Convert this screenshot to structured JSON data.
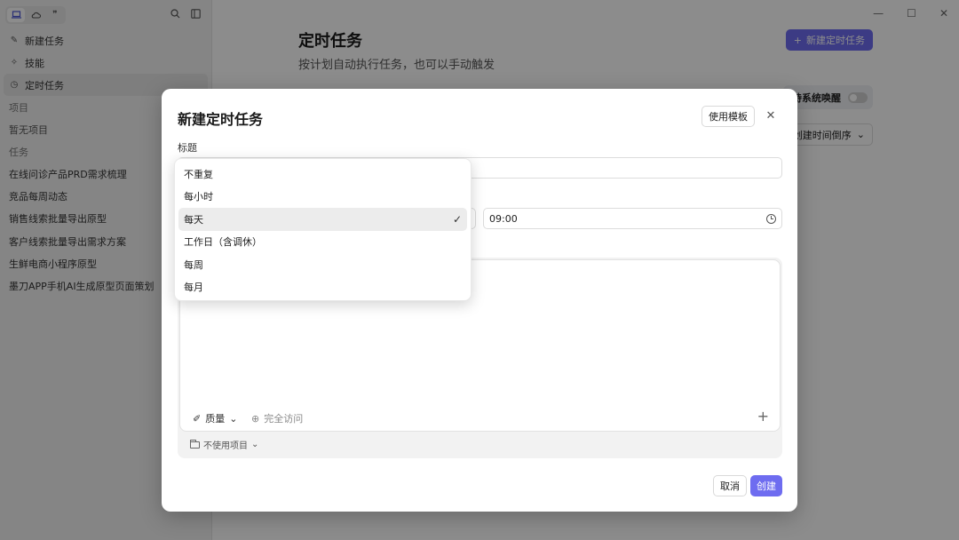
{
  "sidebar": {
    "nav": [
      {
        "label": "新建任务",
        "icon": "edit-icon"
      },
      {
        "label": "技能",
        "icon": "skills-icon"
      },
      {
        "label": "定时任务",
        "icon": "clock-icon"
      }
    ],
    "projects_title": "项目",
    "projects_empty": "暂无项目",
    "tasks_title": "任务",
    "tasks": [
      "在线问诊产品PRD需求梳理",
      "竞品每周动态",
      "销售线索批量导出原型",
      "客户线索批量导出需求方案",
      "生鲜电商小程序原型",
      "墨刀APP手机AI生成原型页面策划"
    ]
  },
  "main": {
    "title": "定时任务",
    "subtitle": "按计划自动执行任务，也可以手动触发",
    "new_button": "新建定时任务",
    "wake_label": "持系统唤醒",
    "sort_label": "创建时间倒序"
  },
  "modal": {
    "title": "新建定时任务",
    "template_button": "使用模板",
    "title_label": "标题",
    "time_value": "09:00",
    "quality_label": "质量",
    "access_label": "完全访问",
    "project_label": "不使用项目",
    "cancel_label": "取消",
    "create_label": "创建"
  },
  "dropdown": {
    "options": [
      "不重复",
      "每小时",
      "每天",
      "工作日（含调休）",
      "每周",
      "每月"
    ],
    "selected": "每天"
  },
  "colors": {
    "accent": "#6e6cf0"
  }
}
